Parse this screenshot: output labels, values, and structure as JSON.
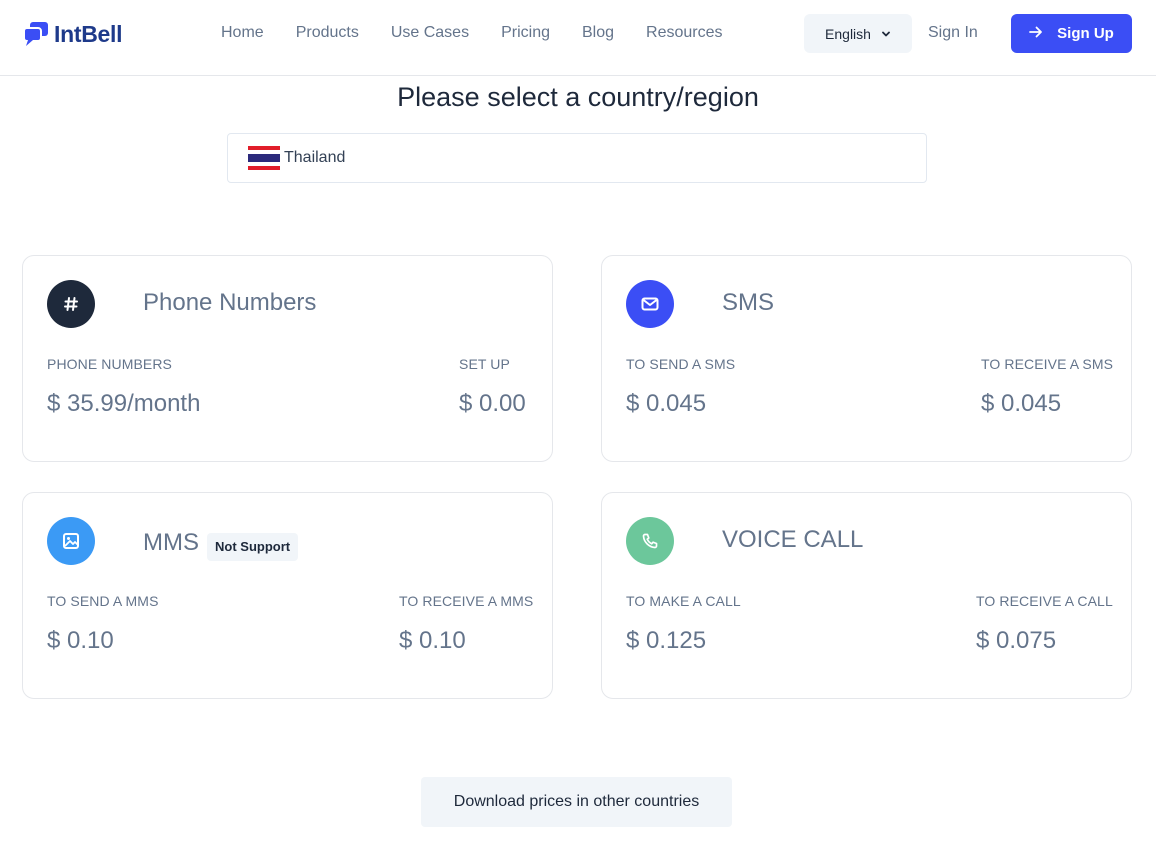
{
  "brand": {
    "name": "IntBell",
    "color": "#3b4ef5"
  },
  "nav": {
    "items": [
      {
        "label": "Home"
      },
      {
        "label": "Products"
      },
      {
        "label": "Use Cases"
      },
      {
        "label": "Pricing"
      },
      {
        "label": "Blog"
      },
      {
        "label": "Resources"
      }
    ],
    "language": "English",
    "sign_in": "Sign In",
    "sign_up": "Sign Up"
  },
  "selector": {
    "title": "Please select a country/region",
    "country": "Thailand",
    "flag_icon": "thailand-flag-icon"
  },
  "cards": {
    "phone": {
      "title": "Phone Numbers",
      "icon": "hash-icon",
      "icon_color": "#1e293b",
      "left_label": "PHONE NUMBERS",
      "left_value": "$ 35.99/month",
      "right_label": "SET UP",
      "right_value": "$ 0.00"
    },
    "sms": {
      "title": "SMS",
      "icon": "envelope-icon",
      "icon_color": "#3b4ef5",
      "left_label": "TO SEND A SMS",
      "left_value": "$ 0.045",
      "right_label": "TO RECEIVE A SMS",
      "right_value": "$ 0.045"
    },
    "mms": {
      "title": "MMS",
      "badge": "Not Support",
      "icon": "image-icon",
      "icon_color": "#3b9af5",
      "left_label": "TO SEND A MMS",
      "left_value": "$ 0.10",
      "right_label": "TO RECEIVE A MMS",
      "right_value": "$ 0.10"
    },
    "voice": {
      "title": "VOICE CALL",
      "icon": "phone-icon",
      "icon_color": "#6cc79b",
      "left_label": "TO MAKE A CALL",
      "left_value": "$ 0.125",
      "right_label": "TO RECEIVE A CALL",
      "right_value": "$ 0.075"
    }
  },
  "download_button": "Download prices in other countries"
}
